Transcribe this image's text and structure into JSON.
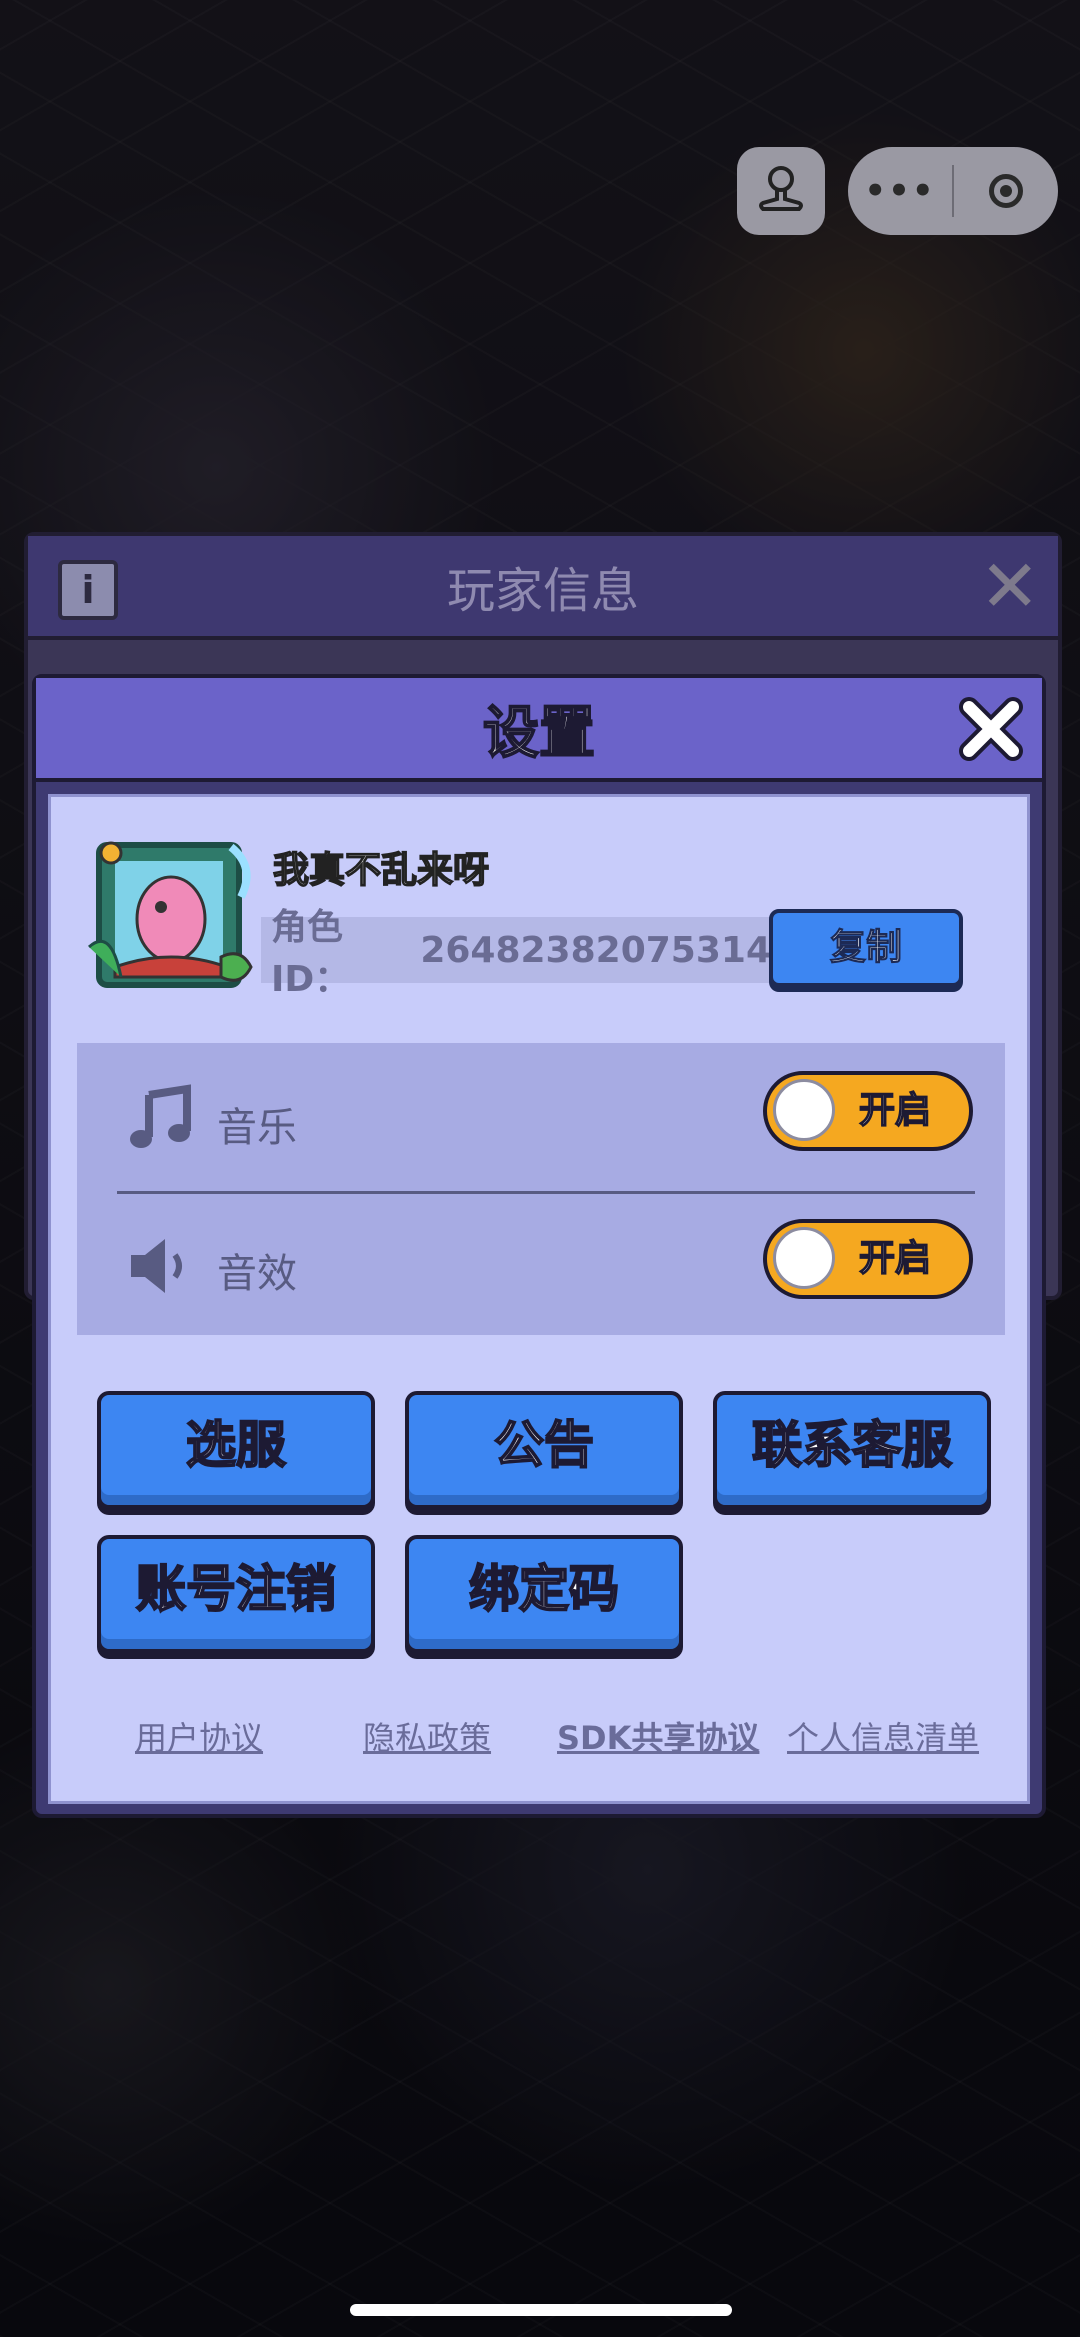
{
  "background_panel": {
    "title": "玩家信息"
  },
  "settings": {
    "title": "设置",
    "nickname": "我真不乱来呀",
    "role_id_label": "角色ID：",
    "role_id": "26482382075314",
    "copy_label": "复制",
    "music_label": "音乐",
    "music_state": "开启",
    "sfx_label": "音效",
    "sfx_state": "开启",
    "buttons": [
      "选服",
      "公告",
      "联系客服",
      "账号注销",
      "绑定码"
    ],
    "links": [
      "用户协议",
      "隐私政策",
      "SDK共享协议",
      "个人信息清单"
    ]
  },
  "colors": {
    "modal_header": "#6b63c9",
    "modal_body": "#c8ccfa",
    "button_blue": "#3d86f2",
    "toggle_on": "#f5a820"
  },
  "icons": [
    "person-icon",
    "more-dots-icon",
    "record-icon",
    "info-icon",
    "close-icon",
    "music-note-icon",
    "speaker-icon"
  ]
}
